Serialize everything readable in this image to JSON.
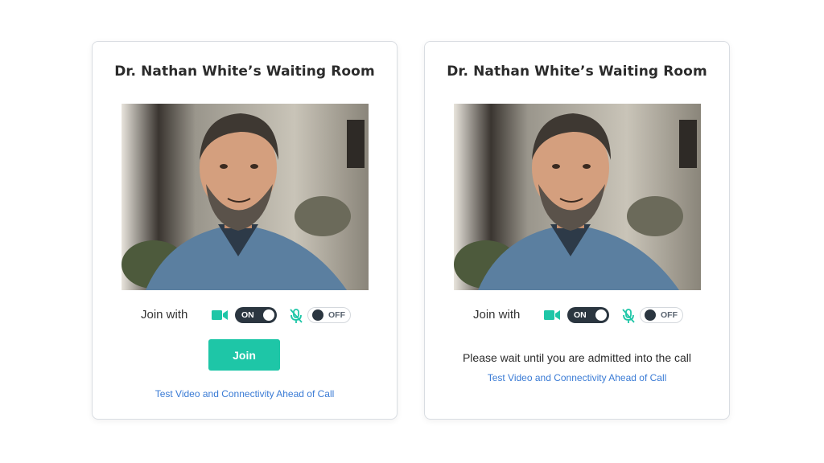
{
  "cards": [
    {
      "title": "Dr. Nathan White’s Waiting Room",
      "join_with": "Join with",
      "camera_toggle": {
        "label": "ON",
        "state": "on"
      },
      "mic_toggle": {
        "label": "OFF",
        "state": "off"
      },
      "join_button": "Join",
      "test_link": "Test Video and Connectivity Ahead of Call"
    },
    {
      "title": "Dr. Nathan White’s Waiting Room",
      "join_with": "Join with",
      "camera_toggle": {
        "label": "ON",
        "state": "on"
      },
      "mic_toggle": {
        "label": "OFF",
        "state": "off"
      },
      "wait_message": "Please wait until you are admitted into the call",
      "test_link": "Test Video and Connectivity Ahead of Call"
    }
  ],
  "icons": {
    "camera": "video-camera-icon",
    "microphone": "microphone-muted-icon"
  },
  "colors": {
    "accent": "#1ec6a7",
    "link": "#3a7bd5",
    "toggle_dark": "#2b3640",
    "mic_muted": "#1ec6a7"
  }
}
